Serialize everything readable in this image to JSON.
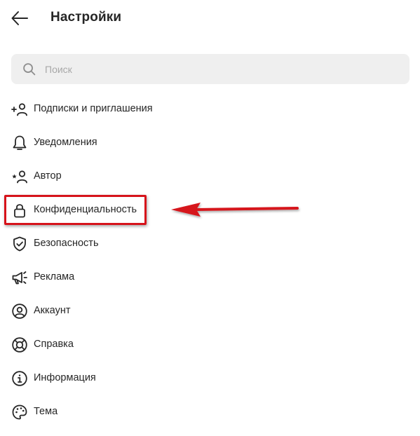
{
  "header": {
    "title": "Настройки",
    "back_icon": "arrow-left-icon"
  },
  "search": {
    "placeholder": "Поиск",
    "value": "",
    "icon": "search-icon"
  },
  "menu": {
    "items": [
      {
        "label": "Подписки и приглашения",
        "icon": "follow-invite-icon"
      },
      {
        "label": "Уведомления",
        "icon": "bell-icon"
      },
      {
        "label": "Автор",
        "icon": "creator-icon"
      },
      {
        "label": "Конфиденциальность",
        "icon": "lock-icon",
        "highlighted": true
      },
      {
        "label": "Безопасность",
        "icon": "shield-check-icon"
      },
      {
        "label": "Реклама",
        "icon": "megaphone-icon"
      },
      {
        "label": "Аккаунт",
        "icon": "account-circle-icon"
      },
      {
        "label": "Справка",
        "icon": "lifebuoy-icon"
      },
      {
        "label": "Информация",
        "icon": "info-icon"
      },
      {
        "label": "Тема",
        "icon": "palette-icon"
      }
    ]
  },
  "annotation": {
    "color": "#d6131b",
    "target": "Конфиденциальность"
  }
}
